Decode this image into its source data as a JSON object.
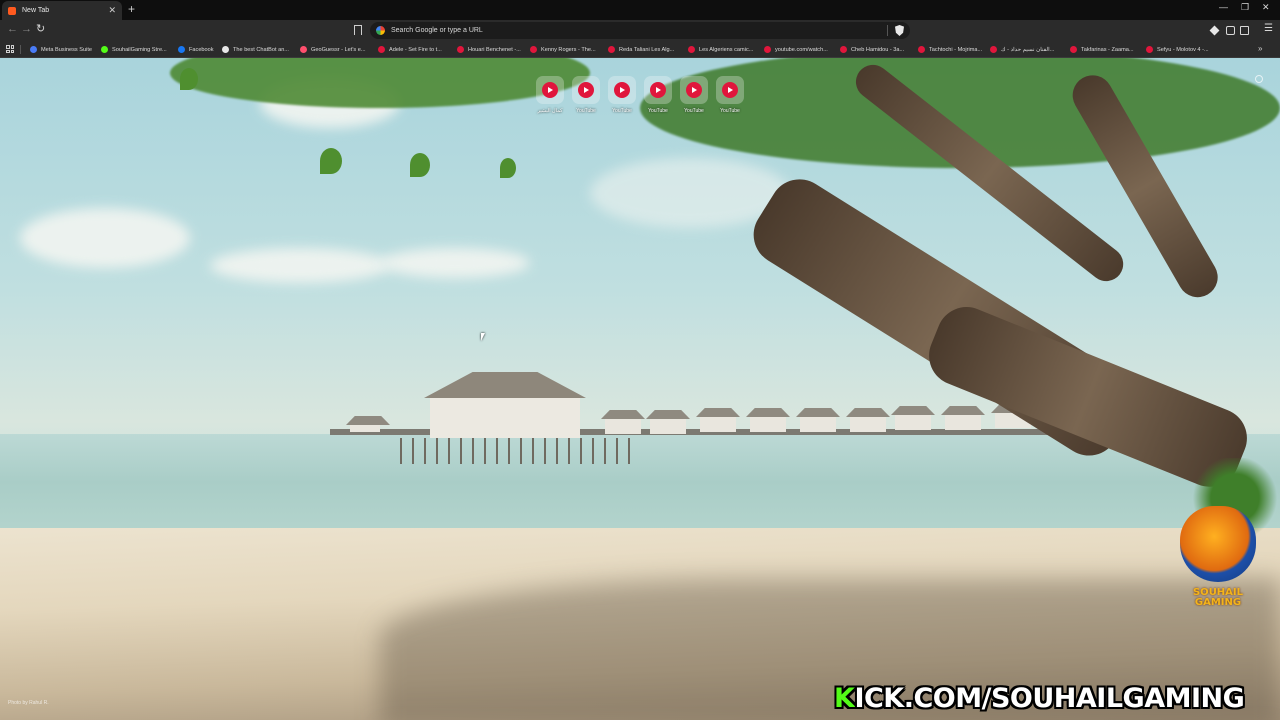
{
  "tabstrip": {
    "tab_title": "New Tab",
    "tab_close": "✕",
    "new_tab": "+",
    "minimize": "—",
    "maximize": "❐",
    "close": "✕"
  },
  "toolbar": {
    "back": "←",
    "forward": "→",
    "reload": "↻",
    "omnibox_placeholder": "Search Google or type a URL",
    "menu": "☰"
  },
  "bookmarks": [
    {
      "label": "Meta Business Suite",
      "icon_color": "#4a7cf7"
    },
    {
      "label": "SouhailGaming Stre...",
      "icon_color": "#53fc18"
    },
    {
      "label": "Facebook",
      "icon_color": "#1877f2"
    },
    {
      "label": "The best ChatBot an...",
      "icon_color": "#e8e8e8"
    },
    {
      "label": "GeoGuessr - Let's e...",
      "icon_color": "#ff4f6d"
    },
    {
      "label": "Adele - Set Fire to t...",
      "icon_color": "#e0163c"
    },
    {
      "label": "Houari Benchenet -...",
      "icon_color": "#e0163c"
    },
    {
      "label": "Kenny Rogers - The...",
      "icon_color": "#e0163c"
    },
    {
      "label": "Reda Taliani Les Alg...",
      "icon_color": "#e0163c"
    },
    {
      "label": "Les Algeriens camic...",
      "icon_color": "#e0163c"
    },
    {
      "label": "youtube.com/watch...",
      "icon_color": "#e0163c"
    },
    {
      "label": "Cheb Hamidou - 3a...",
      "icon_color": "#e0163c"
    },
    {
      "label": "Tachtochi - Mojrima...",
      "icon_color": "#e0163c"
    },
    {
      "label": "الفنان نسيم حداد - ك...",
      "icon_color": "#e0163c"
    },
    {
      "label": "Takfarinas - Zaama...",
      "icon_color": "#e0163c"
    },
    {
      "label": "Sefyu - Molotov 4 -...",
      "icon_color": "#e0163c"
    }
  ],
  "bookmarks_more": "»",
  "shortcuts": [
    {
      "label": "كمال البشير"
    },
    {
      "label": "YouTube"
    },
    {
      "label": "YouTube"
    },
    {
      "label": "YouTube"
    },
    {
      "label": "YouTube"
    },
    {
      "label": "YouTube"
    }
  ],
  "photo_credit": "Photo by Rahul R.",
  "overlay": {
    "logo_line1": "SOUHAIL",
    "logo_line2": "GAMING",
    "kick_k": "K",
    "kick_rest": "ICK.COM/SOUHAILGAMING",
    "kick_color": "#53fc18"
  }
}
